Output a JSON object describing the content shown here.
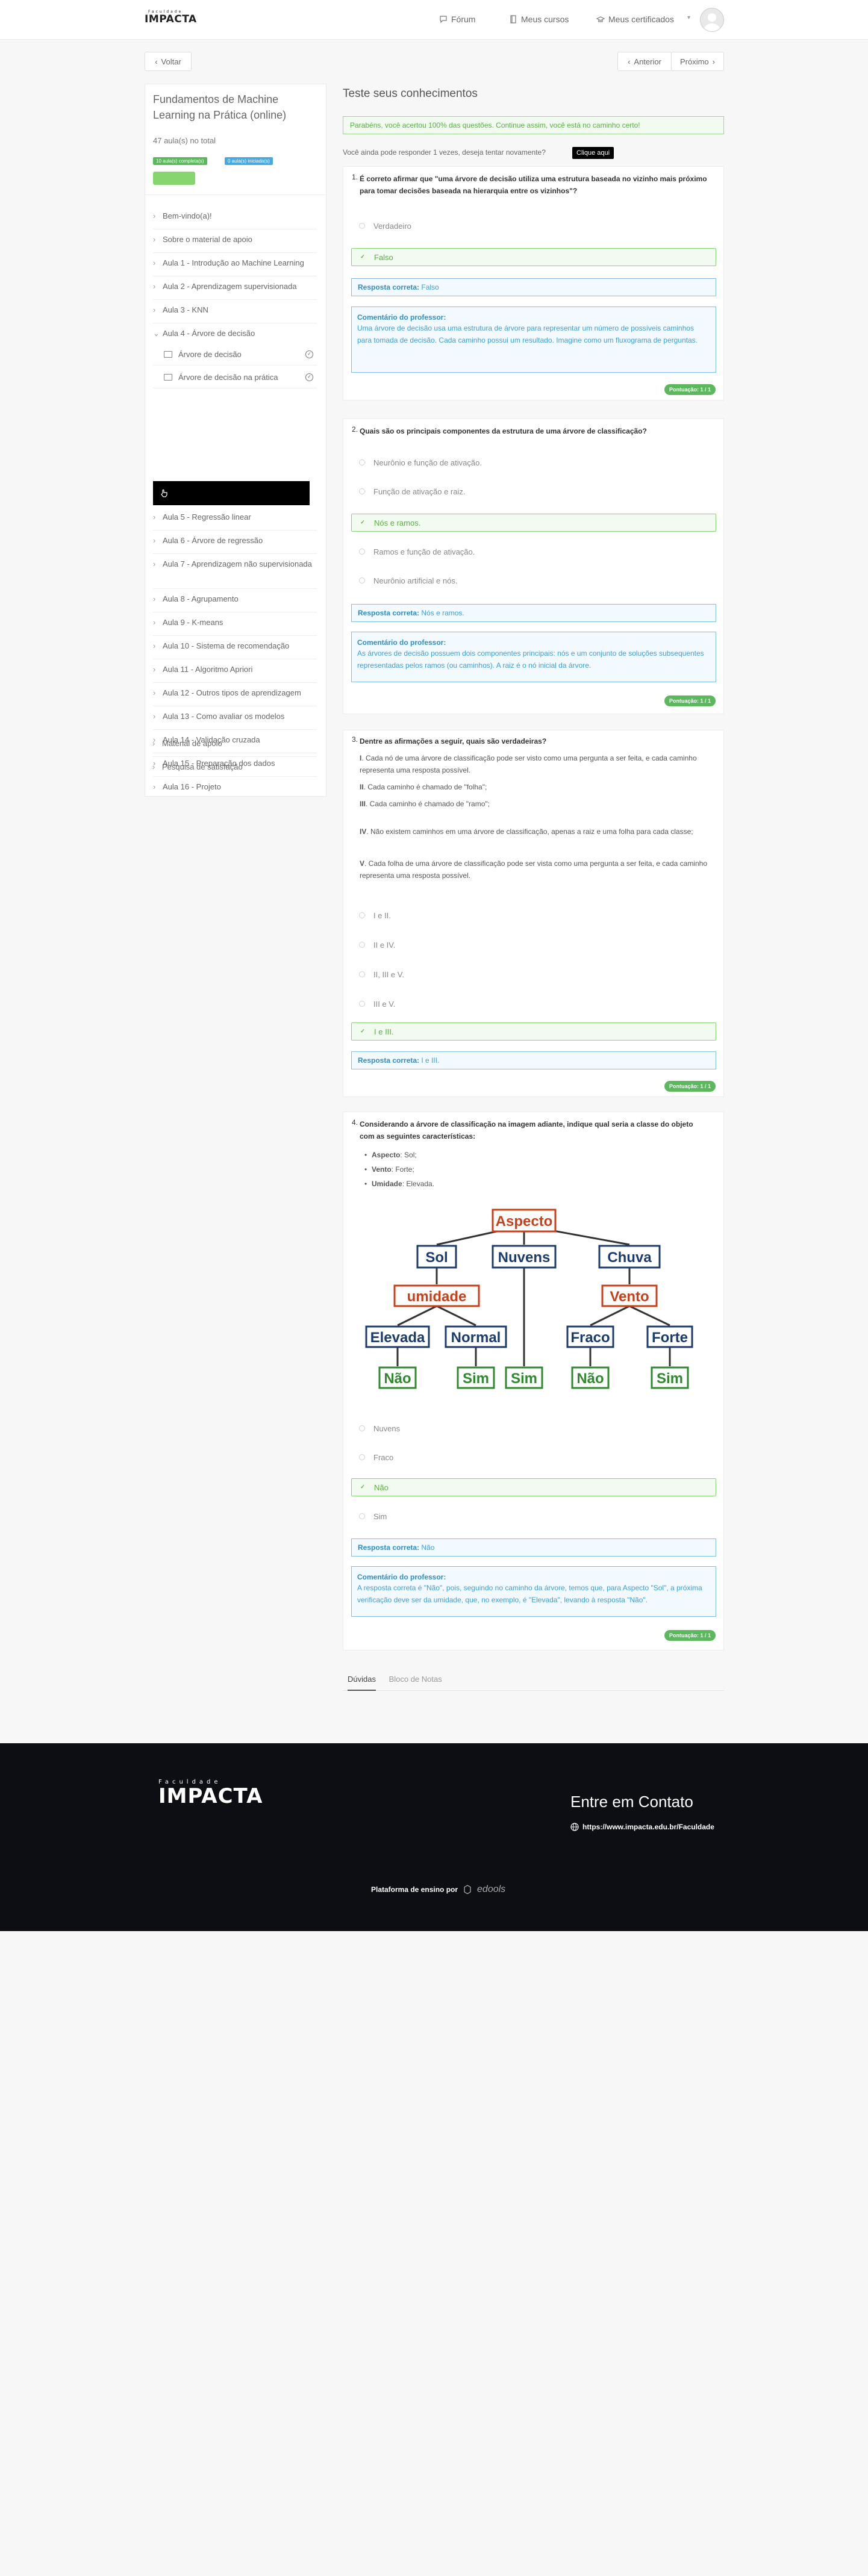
{
  "header": {
    "logo": "IMPACTA",
    "logo_small": "Faculdade",
    "nav": {
      "forum": "Fórum",
      "courses": "Meus cursos",
      "certificates": "Meus certificados"
    }
  },
  "nav_buttons": {
    "back": "Voltar",
    "prev": "Anterior",
    "next": "Próximo"
  },
  "sidebar": {
    "title": "Fundamentos de Machine Learning na Prática (online)",
    "count": "47 aula(s) no total",
    "badge_completed": "10 aula(s) completa(s)",
    "badge_started": "0 aula(s) iniciada(s)",
    "progress": 0.2,
    "items": [
      {
        "label": "Bem-vindo(a)!"
      },
      {
        "label": "Sobre o material de apoio"
      },
      {
        "label": "Aula 1 - Introdução ao Machine Learning"
      },
      {
        "label": "Aula 2 - Aprendizagem supervisionada"
      },
      {
        "label": "Aula 3 - KNN"
      },
      {
        "label": "Aula 4 - Árvore de decisão"
      },
      {
        "label": "Aula 5 - Regressão linear"
      },
      {
        "label": "Aula 6 - Árvore de regressão"
      },
      {
        "label": "Aula 7 - Aprendizagem não supervisionada"
      },
      {
        "label": "Aula 8 - Agrupamento"
      },
      {
        "label": "Aula 9 - K-means"
      },
      {
        "label": "Aula 10 - Sistema de recomendação"
      },
      {
        "label": "Aula 11 - Algoritmo Apriori"
      },
      {
        "label": "Aula 12 - Outros tipos de aprendizagem"
      },
      {
        "label": "Aula 13 - Como avaliar os modelos"
      },
      {
        "label": "Aula 14 - Validação cruzada"
      },
      {
        "label": "Aula 15 - Preparação dos dados"
      },
      {
        "label": "Aula 16 - Projeto"
      },
      {
        "label": "Material de apoio"
      },
      {
        "label": "Pesquisa de satisfação"
      }
    ],
    "subitems": [
      {
        "label": "Árvore de decisão"
      },
      {
        "label": "Árvore de decisão na prática"
      }
    ]
  },
  "main": {
    "title": "Teste seus conhecimentos",
    "alert": "Parabéns, você acertou 100% das questões. Continue assim, você está no caminho certo!",
    "retry": "Você ainda pode responder 1 vezes, deseja tentar novamente?",
    "retry_button": "Clique aqui",
    "score": "Pontuação: 1 / 1"
  },
  "q1": {
    "num": "1.",
    "text": "É correto afirmar que \"uma árvore de decisão utiliza uma estrutura baseada no vizinho mais próximo para tomar decisões baseada na hierarquia entre os vizinhos\"?",
    "options": [
      "Verdadeiro",
      "Falso"
    ],
    "resp_label": "Resposta correta:",
    "resp": "Falso",
    "com_label": "Comentário do professor:",
    "com": "Uma árvore de decisão usa uma estrutura de árvore para representar um número de possíveis caminhos para tomada de decisão. Cada caminho possui um resultado. Imagine como um fluxograma de perguntas."
  },
  "q2": {
    "num": "2.",
    "text": "Quais são os principais componentes da estrutura de uma árvore de classificação?",
    "options": [
      "Neurônio e função de ativação.",
      "Função de ativação e raiz.",
      "Nós e ramos.",
      "Ramos e função de ativação.",
      "Neurônio artificial e nós."
    ],
    "resp_label": "Resposta correta:",
    "resp": "Nós e ramos.",
    "com_label": "Comentário do professor:",
    "com": "As árvores de decisão possuem dois componentes principais: nós e um conjunto de soluções subsequentes representadas pelos ramos (ou caminhos). A raiz é o nó inicial da árvore."
  },
  "q3": {
    "num": "3.",
    "text": "Dentre as afirmações a seguir, quais são verdadeiras?",
    "s1_n": "I",
    "s1": ". Cada nó de uma árvore de classificação pode ser visto como uma pergunta a ser feita, e cada caminho representa uma resposta possível.",
    "s2_n": "II",
    "s2": ". Cada caminho é chamado de \"folha\";",
    "s3_n": "III",
    "s3": ". Cada caminho é chamado de \"ramo\";",
    "s4_n": "IV",
    "s4": ". Não existem caminhos em uma árvore de classificação, apenas a raiz e uma folha para cada classe;",
    "s5_n": "V",
    "s5": ". Cada folha de uma árvore de classificação pode ser vista como uma pergunta a ser feita, e cada caminho representa uma resposta possível.",
    "options": [
      "I e II.",
      "II e IV.",
      "II, III e V.",
      "III e V.",
      "I e III."
    ],
    "resp_label": "Resposta correta:",
    "resp": "I e III."
  },
  "q4": {
    "num": "4.",
    "text": "Considerando a árvore de classificação na imagem adiante, indique qual seria a classe do objeto com as seguintes características:",
    "b1_k": "Aspecto",
    "b1_v": ": Sol;",
    "b2_k": "Vento",
    "b2_v": ": Forte;",
    "b3_k": "Umidade",
    "b3_v": ": Elevada.",
    "tree": {
      "root": "Aspecto",
      "sol": "Sol",
      "nuvens": "Nuvens",
      "chuva": "Chuva",
      "umidade": "umidade",
      "vento": "Vento",
      "elevada": "Elevada",
      "normal": "Normal",
      "fraco": "Fraco",
      "forte": "Forte",
      "nao": "Não",
      "sim": "Sim"
    },
    "options": [
      "Nuvens",
      "Fraco",
      "Não",
      "Sim"
    ],
    "resp_label": "Resposta correta:",
    "resp": "Não",
    "com_label": "Comentário do professor:",
    "com": "A resposta correta é \"Não\", pois, seguindo no caminho da árvore, temos que, para Aspecto \"Sol\", a próxima verificação deve ser da umidade, que, no exemplo, é \"Elevada\", levando à resposta \"Não\"."
  },
  "tabs": {
    "doubts": "Dúvidas",
    "notes": "Bloco de Notas"
  },
  "footer": {
    "logo_small": "Faculdade",
    "logo": "IMPACTA",
    "contact": "Entre em Contato",
    "url": "https://www.impacta.edu.br/Faculdade",
    "platform": "Plataforma de ensino por",
    "platform_brand": "edools"
  },
  "colors": {
    "green": "#5aad45",
    "blue": "#3a9ee0",
    "tree_orange": "#c8401a",
    "tree_navy": "#1c3c6e",
    "tree_green": "#2f8a2f"
  }
}
